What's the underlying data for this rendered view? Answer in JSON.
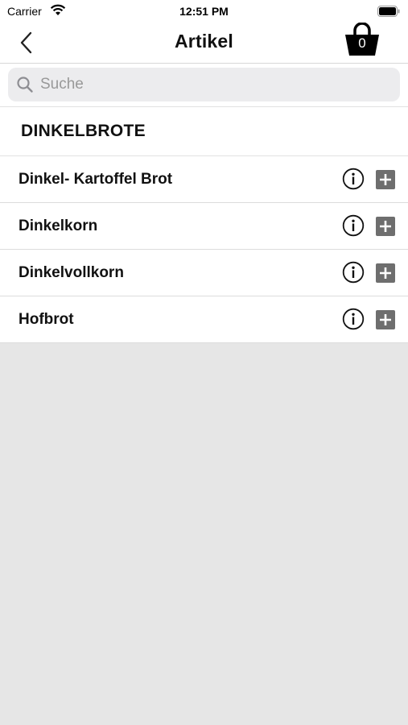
{
  "status_bar": {
    "carrier": "Carrier",
    "time": "12:51 PM",
    "wifi_icon": "wifi-icon",
    "battery_icon": "battery-icon"
  },
  "nav": {
    "title": "Artikel",
    "back_icon": "chevron-left-icon",
    "cart_icon": "basket-icon",
    "cart_count": "0"
  },
  "search": {
    "placeholder": "Suche",
    "value": ""
  },
  "section": {
    "title": "DINKELBROTE"
  },
  "items": [
    {
      "label": "Dinkel- Kartoffel Brot"
    },
    {
      "label": "Dinkelkorn"
    },
    {
      "label": "Dinkelvollkorn"
    },
    {
      "label": "Hofbrot"
    }
  ],
  "colors": {
    "background": "#e6e6e6",
    "icon_gray": "#6e6e6e",
    "text": "#111111"
  }
}
